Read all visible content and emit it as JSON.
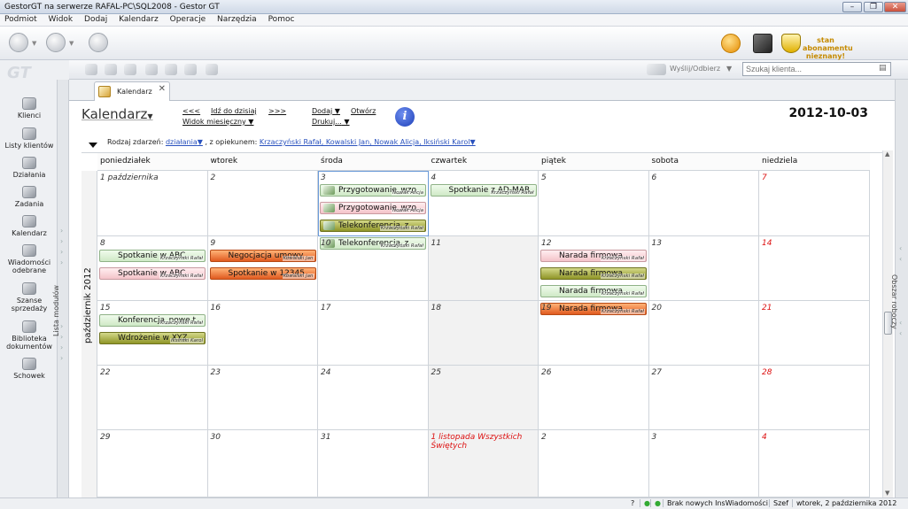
{
  "window": {
    "title": "GestorGT na serwerze RAFAL-PC\\SQL2008 - Gestor GT",
    "min": "–",
    "max": "❐",
    "close": "✕"
  },
  "menu": [
    "Podmiot",
    "Widok",
    "Dodaj",
    "Kalendarz",
    "Operacje",
    "Narzędzia",
    "Pomoc"
  ],
  "toolbar": {
    "subscription": "stan abonamentu nieznany!"
  },
  "sidebar": {
    "logo": "GT",
    "items": [
      "Klienci",
      "Listy klientów",
      "Działania",
      "Zadania",
      "Kalendarz",
      "Wiadomości odebrane",
      "Szanse sprzedaży",
      "Biblioteka dokumentów",
      "Schowek"
    ],
    "strip_label": "Lista modułów"
  },
  "secbar": {
    "send": "Wyślij/Odbierz",
    "search_placeholder": "Szukaj klienta..."
  },
  "tab": {
    "label": "Kalendarz",
    "close": "✕"
  },
  "calendar": {
    "title": "Kalendarz",
    "nav_prev": "<<<",
    "nav_today": "Idź do dzisiaj",
    "nav_next": ">>>",
    "view": "Widok miesięczny",
    "add": "Dodaj",
    "open": "Otwórz",
    "print": "Drukuj...",
    "date": "2012-10-03",
    "filter_label": "Rodzaj zdarzeń:",
    "filter_value": "działania",
    "filter_mid": ", z opiekunem:",
    "filter_owners": "Krzaczyński Rafał, Kowalski Jan, Nowak Alicja, Iksiński Karol",
    "month_label": "październik 2012",
    "weekdays": [
      "poniedziałek",
      "wtorek",
      "środa",
      "czwartek",
      "piątek",
      "sobota",
      "niedziela"
    ],
    "weeks": [
      [
        "1 października",
        "2",
        "3",
        "4",
        "5",
        "6",
        "7"
      ],
      [
        "8",
        "9",
        "10",
        "11",
        "12",
        "13",
        "14"
      ],
      [
        "15",
        "16",
        "17",
        "18",
        "19",
        "20",
        "21"
      ],
      [
        "22",
        "23",
        "24",
        "25",
        "26",
        "27",
        "28"
      ],
      [
        "29",
        "30",
        "31",
        "1 listopada Wszystkich Świętych",
        "2",
        "3",
        "4"
      ]
    ],
    "events": [
      {
        "w": 0,
        "d": 2,
        "slot": 0,
        "title": "Przygotowanie_wzo",
        "owner": "Nowak Alicja",
        "color": "c-green",
        "icon": "task"
      },
      {
        "w": 0,
        "d": 2,
        "slot": 1,
        "title": "Przygotowanie_wzo",
        "owner": "Nowak Alicja",
        "color": "c-pink",
        "icon": "task"
      },
      {
        "w": 0,
        "d": 2,
        "slot": 2,
        "title": "Telekonferencja_z",
        "owner": "Krzaczyński Rafał",
        "color": "c-olive",
        "icon": "task"
      },
      {
        "w": 0,
        "d": 2,
        "slot": 3,
        "title": "Telekonferencja_z",
        "owner": "Krzaczyński Rafał",
        "color": "c-green",
        "icon": "task"
      },
      {
        "w": 0,
        "d": 3,
        "slot": 0,
        "title": "Spotkanie z AD-MAR",
        "owner": "Krzaczyński Rafał",
        "color": "c-green",
        "icon": "meet"
      },
      {
        "w": 1,
        "d": 0,
        "slot": 0,
        "title": "Spotkanie w ABC",
        "owner": "Krzaczyński Rafał",
        "color": "c-green",
        "icon": "meet"
      },
      {
        "w": 1,
        "d": 0,
        "slot": 1,
        "title": "Spotkanie w ABC",
        "owner": "Krzaczyński Rafał",
        "color": "c-pink",
        "icon": "meet"
      },
      {
        "w": 1,
        "d": 1,
        "slot": 0,
        "title": "Negocjacja umowy",
        "owner": "Kowalski Jan",
        "color": "c-orange",
        "icon": "meet"
      },
      {
        "w": 1,
        "d": 1,
        "slot": 1,
        "title": "Spotkanie w 12345",
        "owner": "Kowalski Jan",
        "color": "c-orange",
        "icon": "meet"
      },
      {
        "w": 1,
        "d": 4,
        "slot": 0,
        "title": "Narada firmowa",
        "owner": "Krzaczyński Rafał",
        "color": "c-pink",
        "icon": "meet"
      },
      {
        "w": 1,
        "d": 4,
        "slot": 1,
        "title": "Narada firmowa",
        "owner": "Krzaczyński Rafał",
        "color": "c-olive",
        "icon": "meet"
      },
      {
        "w": 1,
        "d": 4,
        "slot": 2,
        "title": "Narada firmowa",
        "owner": "Krzaczyński Rafał",
        "color": "c-green",
        "icon": "meet"
      },
      {
        "w": 1,
        "d": 4,
        "slot": 3,
        "title": "Narada firmowa",
        "owner": "Krzaczyński Rafał",
        "color": "c-orange",
        "icon": "meet"
      },
      {
        "w": 2,
        "d": 0,
        "slot": 0,
        "title": "Konferencja_nowe t",
        "owner": "Krzaczyński Rafał",
        "color": "c-green",
        "icon": "meet"
      },
      {
        "w": 2,
        "d": 0,
        "slot": 1,
        "title": "Wdrożenie w XYZ",
        "owner": "Iksiński Karol",
        "color": "c-olive",
        "icon": "meet"
      }
    ]
  },
  "rightstrip": {
    "label": "Obszar roboczy"
  },
  "status": {
    "q": "?",
    "msg": "Brak nowych InsWiadomości",
    "user": "Szef",
    "date": "wtorek, 2 października 2012"
  }
}
